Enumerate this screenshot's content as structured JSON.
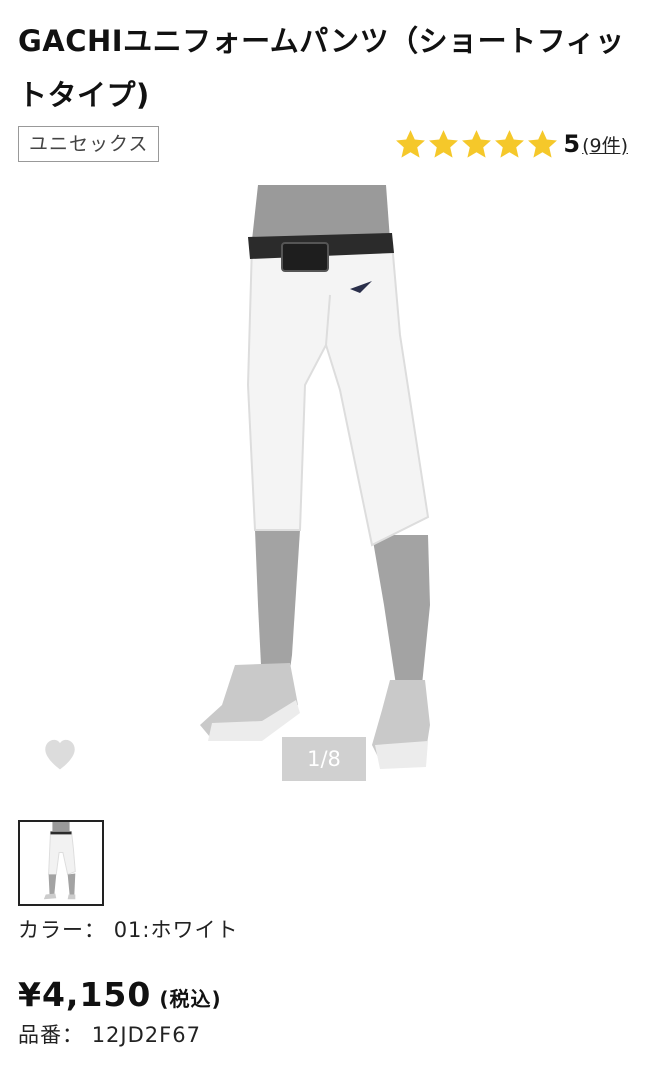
{
  "product": {
    "title": "GACHIユニフォームパンツ（ショートフィットタイプ)",
    "gender_tag": "ユニセックス",
    "rating": {
      "value": "5",
      "count_label": "(9件)",
      "stars": 5,
      "star_color": "#f5c82a"
    },
    "gallery": {
      "counter": "1/8",
      "favorite_icon": "heart-icon"
    },
    "color_label": "カラー：",
    "color_value": "01:ホワイト",
    "price": "¥4,150",
    "tax_label": "(税込)",
    "sku_label": "品番：",
    "sku_value": "12JD2F67"
  }
}
